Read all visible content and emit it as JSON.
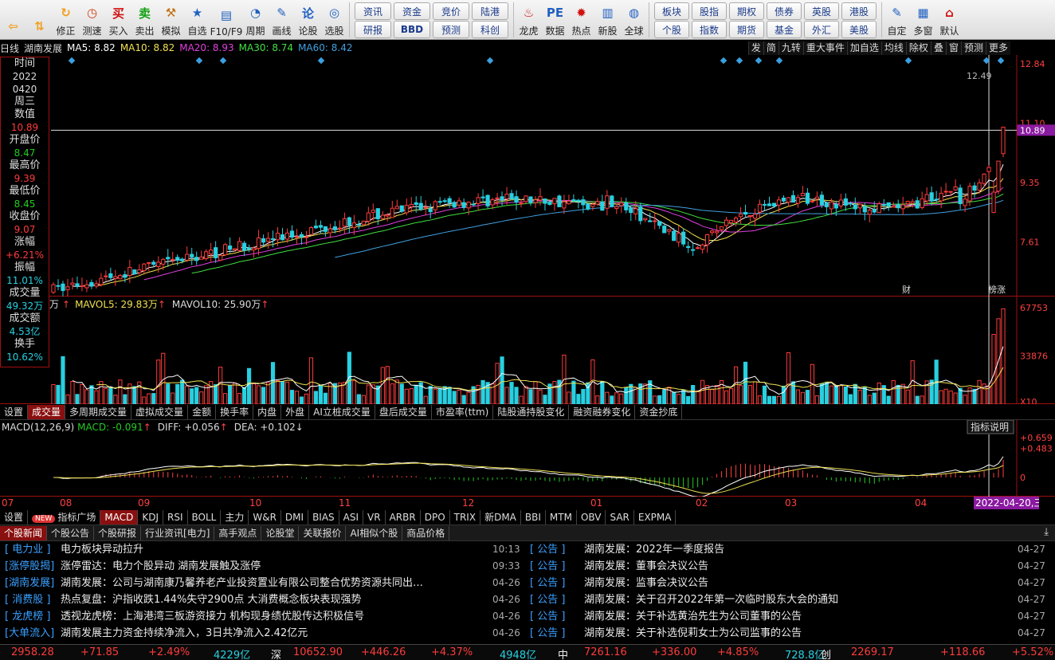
{
  "toolbar": {
    "items": [
      {
        "label": "",
        "icon": "back-arrow-icon",
        "color": "#f0a020"
      },
      {
        "label": "",
        "icon": "up-down-arrow-icon",
        "color": "#f0a020"
      },
      {
        "label": "修正",
        "icon": "revise-icon",
        "color": "#f0a020"
      },
      {
        "label": "测速",
        "icon": "clock-icon",
        "color": "#d04010"
      },
      {
        "label": "买入",
        "icon": "buy-icon",
        "glyph": "买",
        "color": "#d01010"
      },
      {
        "label": "卖出",
        "icon": "sell-icon",
        "glyph": "卖",
        "color": "#10a010"
      },
      {
        "label": "模拟",
        "icon": "hammer-icon",
        "color": "#c07010"
      },
      {
        "label": "自选",
        "icon": "star-icon",
        "color": "#2060c0"
      },
      {
        "label": "F10/F9",
        "icon": "f10-icon",
        "color": "#2060c0"
      },
      {
        "label": "周期",
        "icon": "period-icon",
        "color": "#2060c0"
      },
      {
        "label": "画线",
        "icon": "pen-icon",
        "color": "#2060c0"
      },
      {
        "label": "论股",
        "icon": "discuss-icon",
        "glyph": "论",
        "color": "#2060c0"
      },
      {
        "label": "选股",
        "icon": "select-stock-icon",
        "color": "#2060c0"
      }
    ],
    "grid1": [
      "资讯",
      "资金",
      "竞价",
      "陆港",
      "研报",
      "BBD",
      "预测",
      "科创"
    ],
    "items2": [
      {
        "label": "龙虎",
        "icon": "dragon-tiger-icon",
        "color": "#d01010"
      },
      {
        "label": "数据",
        "icon": "pe-icon",
        "glyph": "PE",
        "color": "#2060c0"
      },
      {
        "label": "热点",
        "icon": "hot-icon",
        "color": "#d01010"
      },
      {
        "label": "新股",
        "icon": "new-stock-icon",
        "color": "#2060c0"
      },
      {
        "label": "全球",
        "icon": "globe-icon",
        "color": "#2060c0"
      }
    ],
    "grid2": [
      "板块",
      "股指",
      "期权",
      "债券",
      "英股",
      "港股",
      "个股",
      "指数",
      "期货",
      "基金",
      "外汇",
      "美股"
    ],
    "items3": [
      {
        "label": "自定",
        "icon": "custom-icon",
        "color": "#2060c0"
      },
      {
        "label": "多窗",
        "icon": "multi-window-icon",
        "color": "#2060c0"
      },
      {
        "label": "默认",
        "icon": "home-icon",
        "color": "#d01010"
      }
    ]
  },
  "infobar": {
    "period": "日线",
    "stock": "湖南发展",
    "ma5": "MA5: 8.82",
    "ma10": "MA10: 8.82",
    "ma20": "MA20: 8.93",
    "ma30": "MA30: 8.74",
    "ma60": "MA60: 8.42",
    "right_buttons": [
      "发",
      "简",
      "九转",
      "重大事件",
      "加自选",
      "均线",
      "除权",
      "叠",
      "窗",
      "预测",
      "更多"
    ]
  },
  "data_window": {
    "rows": [
      {
        "label": "时间",
        "value": "2022",
        "color": "#dddddd"
      },
      {
        "label": "",
        "value": "0420",
        "color": "#dddddd"
      },
      {
        "label": "周三",
        "value": "",
        "color": "#dddddd"
      },
      {
        "label": "数值",
        "value": "10.89",
        "color": "#ff3b3b"
      },
      {
        "label": "开盘价",
        "value": "8.47",
        "color": "#22cc22"
      },
      {
        "label": "最高价",
        "value": "9.39",
        "color": "#ff3b3b"
      },
      {
        "label": "最低价",
        "value": "8.45",
        "color": "#22cc22"
      },
      {
        "label": "收盘价",
        "value": "9.07",
        "color": "#ff3b3b"
      },
      {
        "label": "涨幅",
        "value": "+6.21%",
        "color": "#ff3b3b"
      },
      {
        "label": "振幅",
        "value": "11.01%",
        "color": "#28d0e0"
      },
      {
        "label": "成交量",
        "value": "49.32万",
        "color": "#28d0e0"
      },
      {
        "label": "成交额",
        "value": "4.53亿",
        "color": "#28d0e0"
      },
      {
        "label": "换手",
        "value": "10.62%",
        "color": "#28d0e0"
      }
    ]
  },
  "main_chart": {
    "y_labels": [
      "12.84",
      "11.10",
      "10.89",
      "9.35",
      "7.61"
    ],
    "hover_price": "12.49",
    "markers": [
      "财",
      "榜涨"
    ]
  },
  "volume": {
    "title_vol": "万",
    "mavol5": "MAVOL5: 29.83万",
    "mavol10": "MAVOL10: 25.90万",
    "y_labels": [
      "67753",
      "33876",
      "X10"
    ],
    "tabs": [
      "设置",
      "成交量",
      "多周期成交量",
      "虚拟成交量",
      "金额",
      "换手率",
      "内盘",
      "外盘",
      "AI立桩成交量",
      "盘后成交量",
      "市盈率(ttm)",
      "陆股通持股变化",
      "融资融券变化",
      "资金抄底"
    ]
  },
  "macd": {
    "title": "MACD(12,26,9)",
    "macd": "MACD: -0.091",
    "diff": "DIFF: +0.056",
    "dea": "DEA: +0.102",
    "explain_button": "指标说明",
    "y_labels": [
      "+0.659",
      "+0.483",
      "0"
    ]
  },
  "x_axis": {
    "months": [
      "07",
      "08",
      "09",
      "10",
      "11",
      "12",
      "01",
      "02",
      "03",
      "04"
    ],
    "cursor_date": "2022-04-20,三"
  },
  "indicator_tabs": [
    "设置",
    "指标广场",
    "MACD",
    "KDJ",
    "RSI",
    "BOLL",
    "主力",
    "W&R",
    "DMI",
    "BIAS",
    "ASI",
    "VR",
    "ARBR",
    "DPO",
    "TRIX",
    "新DMA",
    "BBI",
    "MTM",
    "OBV",
    "SAR",
    "EXPMA"
  ],
  "news_tabs": [
    "个股新闻",
    "个股公告",
    "个股研报",
    "行业资讯[电力]",
    "高手观点",
    "论股堂",
    "关联报价",
    "AI相似个股",
    "商品价格"
  ],
  "news_left": [
    {
      "cat": "[ 电力业 ]",
      "text": "电力板块异动拉升",
      "time": "10:13"
    },
    {
      "cat": "[涨停股揭]",
      "text": "涨停雷达：电力个股异动 湖南发展触及涨停",
      "time": "09:33"
    },
    {
      "cat": "[湖南发展]",
      "text": "湖南发展：公司与湖南康乃馨养老产业投资置业有限公司整合优势资源共同出…",
      "time": "04-26"
    },
    {
      "cat": "[ 消费股 ]",
      "text": "热点复盘：沪指收跌1.44%失守2900点 大消费概念板块表现强势",
      "time": "04-26"
    },
    {
      "cat": "[ 龙虎榜 ]",
      "text": "透视龙虎榜：上海港湾三板游资接力 机构现身绩优股传达积极信号",
      "time": "04-26"
    },
    {
      "cat": "[大单流入]",
      "text": "湖南发展主力资金持续净流入，3日共净流入2.42亿元",
      "time": "04-26"
    }
  ],
  "news_right": [
    {
      "cat": "[  公告  ]",
      "text": "湖南发展：2022年一季度报告",
      "time": "04-27"
    },
    {
      "cat": "[  公告  ]",
      "text": "湖南发展：董事会决议公告",
      "time": "04-27"
    },
    {
      "cat": "[  公告  ]",
      "text": "湖南发展：监事会决议公告",
      "time": "04-27"
    },
    {
      "cat": "[  公告  ]",
      "text": "湖南发展：关于召开2022年第一次临时股东大会的通知",
      "time": "04-27"
    },
    {
      "cat": "[  公告  ]",
      "text": "湖南发展：关于补选黄治先生为公司董事的公告",
      "time": "04-27"
    },
    {
      "cat": "[  公告  ]",
      "text": "湖南发展：关于补选倪莉女士为公司监事的公告",
      "time": "04-27"
    }
  ],
  "status": {
    "sh_index": "2958.28",
    "sh_change": "+71.85",
    "sh_pct": "+2.49%",
    "sh_amount": "4229亿",
    "sz_label": "深",
    "sz_index": "10652.90",
    "sz_change": "+446.26",
    "sz_pct": "+4.37%",
    "sz_amount": "4948亿",
    "zx_label": "中",
    "zx_index": "7261.16",
    "zx_change": "+336.00",
    "zx_pct": "+4.85%",
    "zx_amount": "728.8亿",
    "cy_label": "创",
    "cy_index": "2269.17",
    "cy_change": "+118.66",
    "cy_pct": "+5.52%"
  },
  "colors": {
    "up": "#ff3b3b",
    "down": "#28d0e0",
    "grid_border": "#a01010",
    "ma5": "#ffffff",
    "ma10": "#f0e050",
    "ma20": "#e040e0",
    "ma30": "#40e040",
    "ma60": "#40a0e0"
  }
}
